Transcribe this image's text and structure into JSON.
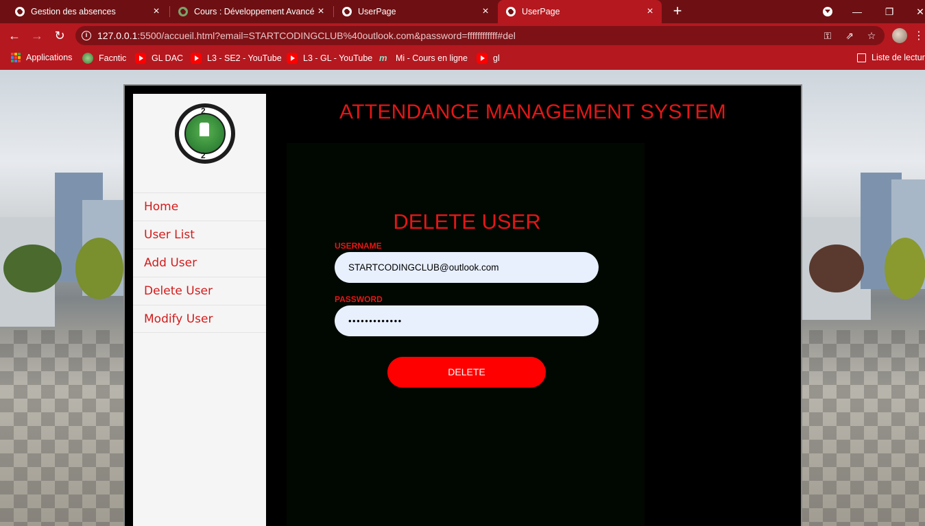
{
  "browser": {
    "tabs": [
      {
        "title": "Gestion des absences",
        "active": false
      },
      {
        "title": "Cours : Développement Avancé c",
        "active": false
      },
      {
        "title": "UserPage",
        "active": false
      },
      {
        "title": "UserPage",
        "active": true
      }
    ],
    "url_host": "127.0.0.1",
    "url_rest": ":5500/accueil.html?email=STARTCODINGCLUB%40outlook.com&password=ffffffffffff#del",
    "bookmarks": [
      {
        "label": "Applications",
        "icon": "apps-icon"
      },
      {
        "label": "Facntic",
        "icon": "site-icon"
      },
      {
        "label": "GL DAC",
        "icon": "youtube-icon"
      },
      {
        "label": "L3 - SE2 - YouTube",
        "icon": "youtube-icon"
      },
      {
        "label": "L3 - GL - YouTube",
        "icon": "youtube-icon"
      },
      {
        "label": "Mi - Cours en ligne",
        "icon": "moodle-icon"
      },
      {
        "label": "gl",
        "icon": "youtube-icon"
      }
    ],
    "reading_list": "Liste de lecture"
  },
  "app": {
    "title": "ATTENDANCE MANAGEMENT SYSTEM",
    "menu": [
      {
        "label": "Home"
      },
      {
        "label": "User List"
      },
      {
        "label": "Add User"
      },
      {
        "label": "Delete User"
      },
      {
        "label": "Modify User"
      }
    ],
    "form": {
      "title": "DELETE USER",
      "username_label": "USERNAME",
      "username_value": "STARTCODINGCLUB@outlook.com",
      "password_label": "PASSWORD",
      "password_value": "•••••••••••••",
      "submit_label": "DELETE"
    }
  },
  "colors": {
    "chrome_dark": "#6e1013",
    "chrome": "#b5181f",
    "accent_red": "#e31616",
    "button_red": "#ff0000",
    "input_bg": "#e8f0fe"
  }
}
